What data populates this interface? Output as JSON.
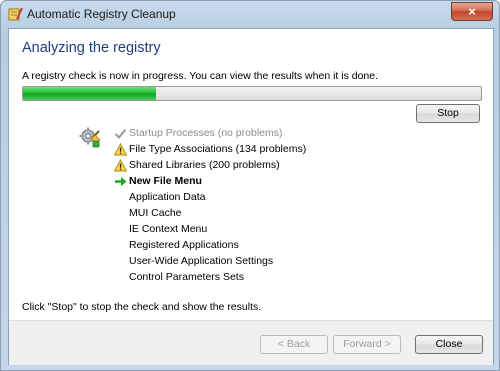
{
  "window": {
    "title": "Automatic Registry Cleanup",
    "close_glyph": "×"
  },
  "main": {
    "heading": "Analyzing the registry",
    "intro": "A registry check is now in progress. You can view the results when it is done.",
    "progress_fraction": 0.29,
    "stop_label": "Stop",
    "tasks": [
      {
        "label": "Startup Processes (no problems)",
        "status": "done",
        "icon": "checkmark-icon"
      },
      {
        "label": "File Type Associations (134 problems)",
        "status": "warning",
        "icon": "warning-icon"
      },
      {
        "label": "Shared Libraries (200 problems)",
        "status": "warning",
        "icon": "warning-icon"
      },
      {
        "label": "New File Menu",
        "status": "current",
        "icon": "arrow-right-icon"
      },
      {
        "label": "Application Data",
        "status": "pending",
        "icon": ""
      },
      {
        "label": "MUI Cache",
        "status": "pending",
        "icon": ""
      },
      {
        "label": "IE Context Menu",
        "status": "pending",
        "icon": ""
      },
      {
        "label": "Registered Applications",
        "status": "pending",
        "icon": ""
      },
      {
        "label": "User-Wide Application Settings",
        "status": "pending",
        "icon": ""
      },
      {
        "label": "Control Parameters Sets",
        "status": "pending",
        "icon": ""
      }
    ],
    "footer_note": "Click \"Stop\" to stop the check and show the results."
  },
  "footer": {
    "back_label": "< Back",
    "forward_label": "Forward >",
    "close_label": "Close"
  },
  "colors": {
    "heading": "#1e3c8c",
    "progress": "#1fb82f",
    "done_text": "#8c8c8c",
    "current_arrow": "#1aa51f"
  }
}
